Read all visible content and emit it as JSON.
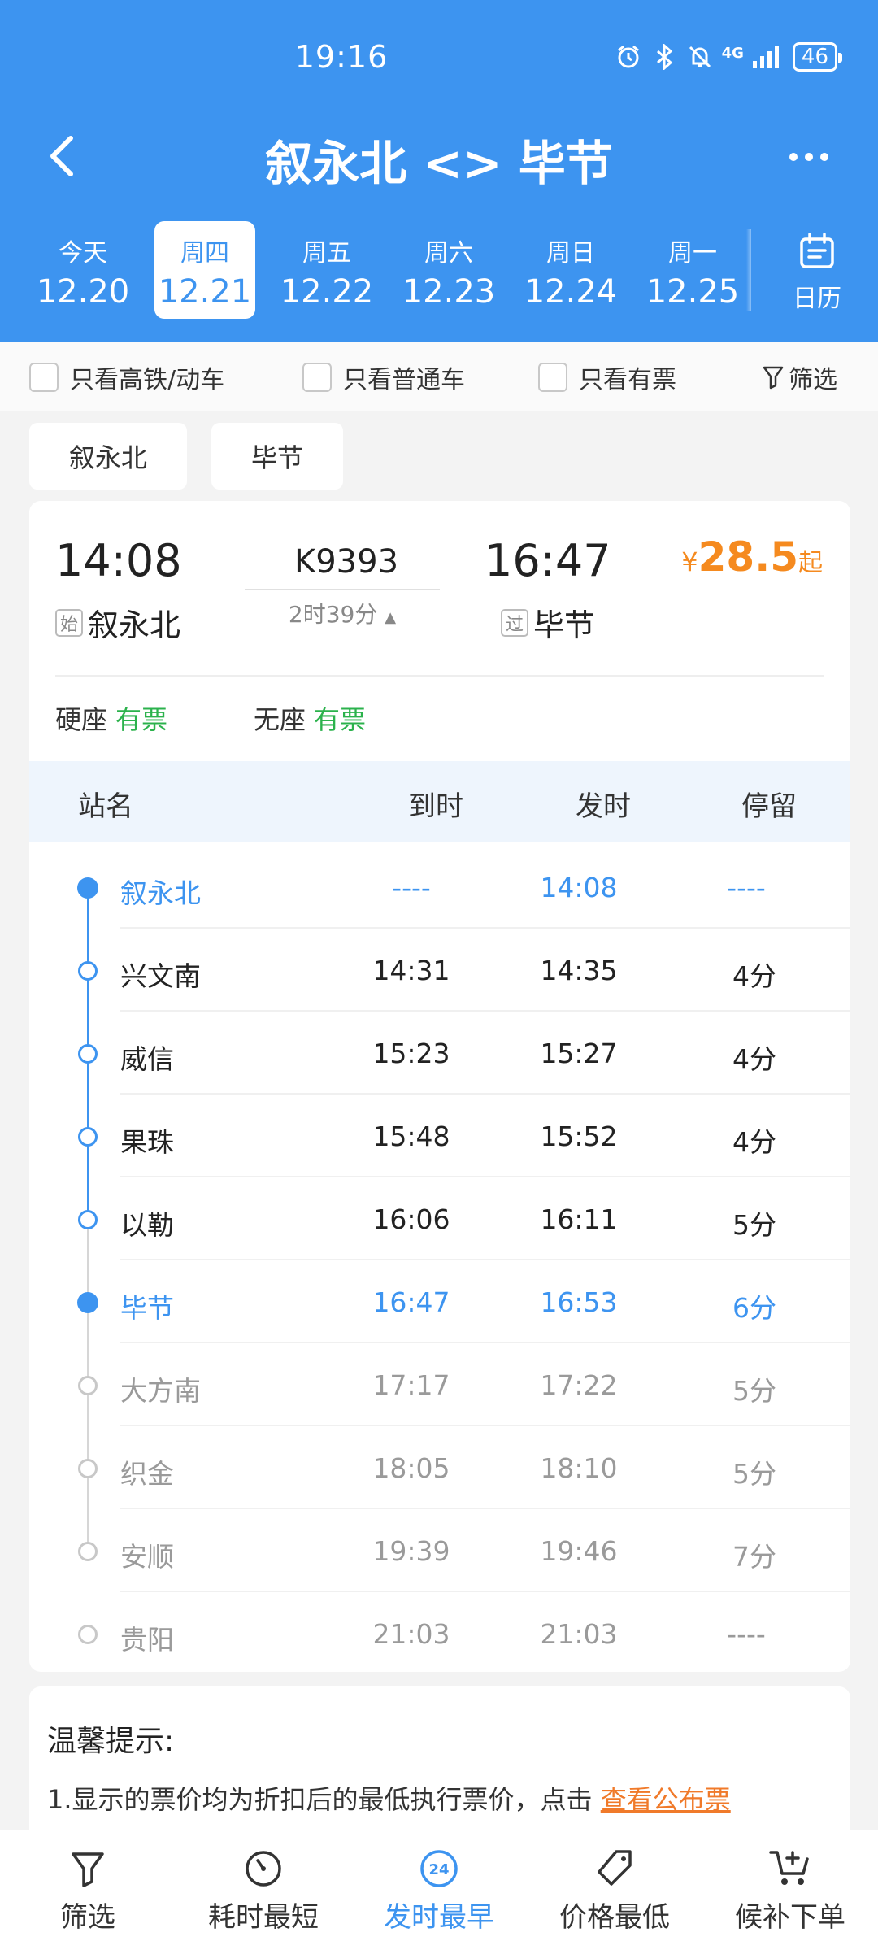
{
  "status_bar": {
    "time": "19:16",
    "signal": "4G",
    "battery": "46"
  },
  "header": {
    "title": "叙永北 <> 毕节"
  },
  "dates": [
    {
      "weekday": "今天",
      "date": "12.20",
      "active": false
    },
    {
      "weekday": "周四",
      "date": "12.21",
      "active": true
    },
    {
      "weekday": "周五",
      "date": "12.22",
      "active": false
    },
    {
      "weekday": "周六",
      "date": "12.23",
      "active": false
    },
    {
      "weekday": "周日",
      "date": "12.24",
      "active": false
    },
    {
      "weekday": "周一",
      "date": "12.25",
      "active": false
    }
  ],
  "calendar_label": "日历",
  "filters": {
    "high_speed": "只看高铁/动车",
    "regular": "只看普通车",
    "available": "只看有票",
    "filter": "筛选"
  },
  "station_chips": [
    "叙永北",
    "毕节"
  ],
  "train": {
    "dep_time": "14:08",
    "dep_tag": "始",
    "dep_station": "叙永北",
    "number": "K9393",
    "duration": "2时39分",
    "arr_time": "16:47",
    "arr_tag": "过",
    "arr_station": "毕节",
    "price_currency": "¥",
    "price": "28.5",
    "price_suffix": "起",
    "seats": [
      {
        "type": "硬座",
        "status": "有票"
      },
      {
        "type": "无座",
        "status": "有票"
      }
    ]
  },
  "stops_header": {
    "station": "站名",
    "arrive": "到时",
    "depart": "发时",
    "stay": "停留"
  },
  "stops": [
    {
      "name": "叙永北",
      "arrive": "----",
      "depart": "14:08",
      "stay": "----",
      "kind": "key"
    },
    {
      "name": "兴文南",
      "arrive": "14:31",
      "depart": "14:35",
      "stay": "4分",
      "kind": "norm"
    },
    {
      "name": "威信",
      "arrive": "15:23",
      "depart": "15:27",
      "stay": "4分",
      "kind": "norm"
    },
    {
      "name": "果珠",
      "arrive": "15:48",
      "depart": "15:52",
      "stay": "4分",
      "kind": "norm"
    },
    {
      "name": "以勒",
      "arrive": "16:06",
      "depart": "16:11",
      "stay": "5分",
      "kind": "norm"
    },
    {
      "name": "毕节",
      "arrive": "16:47",
      "depart": "16:53",
      "stay": "6分",
      "kind": "key"
    },
    {
      "name": "大方南",
      "arrive": "17:17",
      "depart": "17:22",
      "stay": "5分",
      "kind": "after"
    },
    {
      "name": "织金",
      "arrive": "18:05",
      "depart": "18:10",
      "stay": "5分",
      "kind": "after"
    },
    {
      "name": "安顺",
      "arrive": "19:39",
      "depart": "19:46",
      "stay": "7分",
      "kind": "after"
    },
    {
      "name": "贵阳",
      "arrive": "21:03",
      "depart": "21:03",
      "stay": "----",
      "kind": "after"
    }
  ],
  "tips": {
    "title": "温馨提示:",
    "text": "1.显示的票价均为折扣后的最低执行票价，点击",
    "link": "查看公布票"
  },
  "bottom_nav": [
    {
      "label": "筛选",
      "icon": "filter-icon",
      "active": false
    },
    {
      "label": "耗时最短",
      "icon": "timer-icon",
      "active": false
    },
    {
      "label": "发时最早",
      "icon": "clock-24-icon",
      "active": true
    },
    {
      "label": "价格最低",
      "icon": "price-tag-icon",
      "active": false
    },
    {
      "label": "候补下单",
      "icon": "cart-add-icon",
      "active": false
    }
  ],
  "colors": {
    "primary": "#3d94f0",
    "price": "#f58a1f",
    "available": "#2bb24c",
    "link": "#f07a2a"
  }
}
